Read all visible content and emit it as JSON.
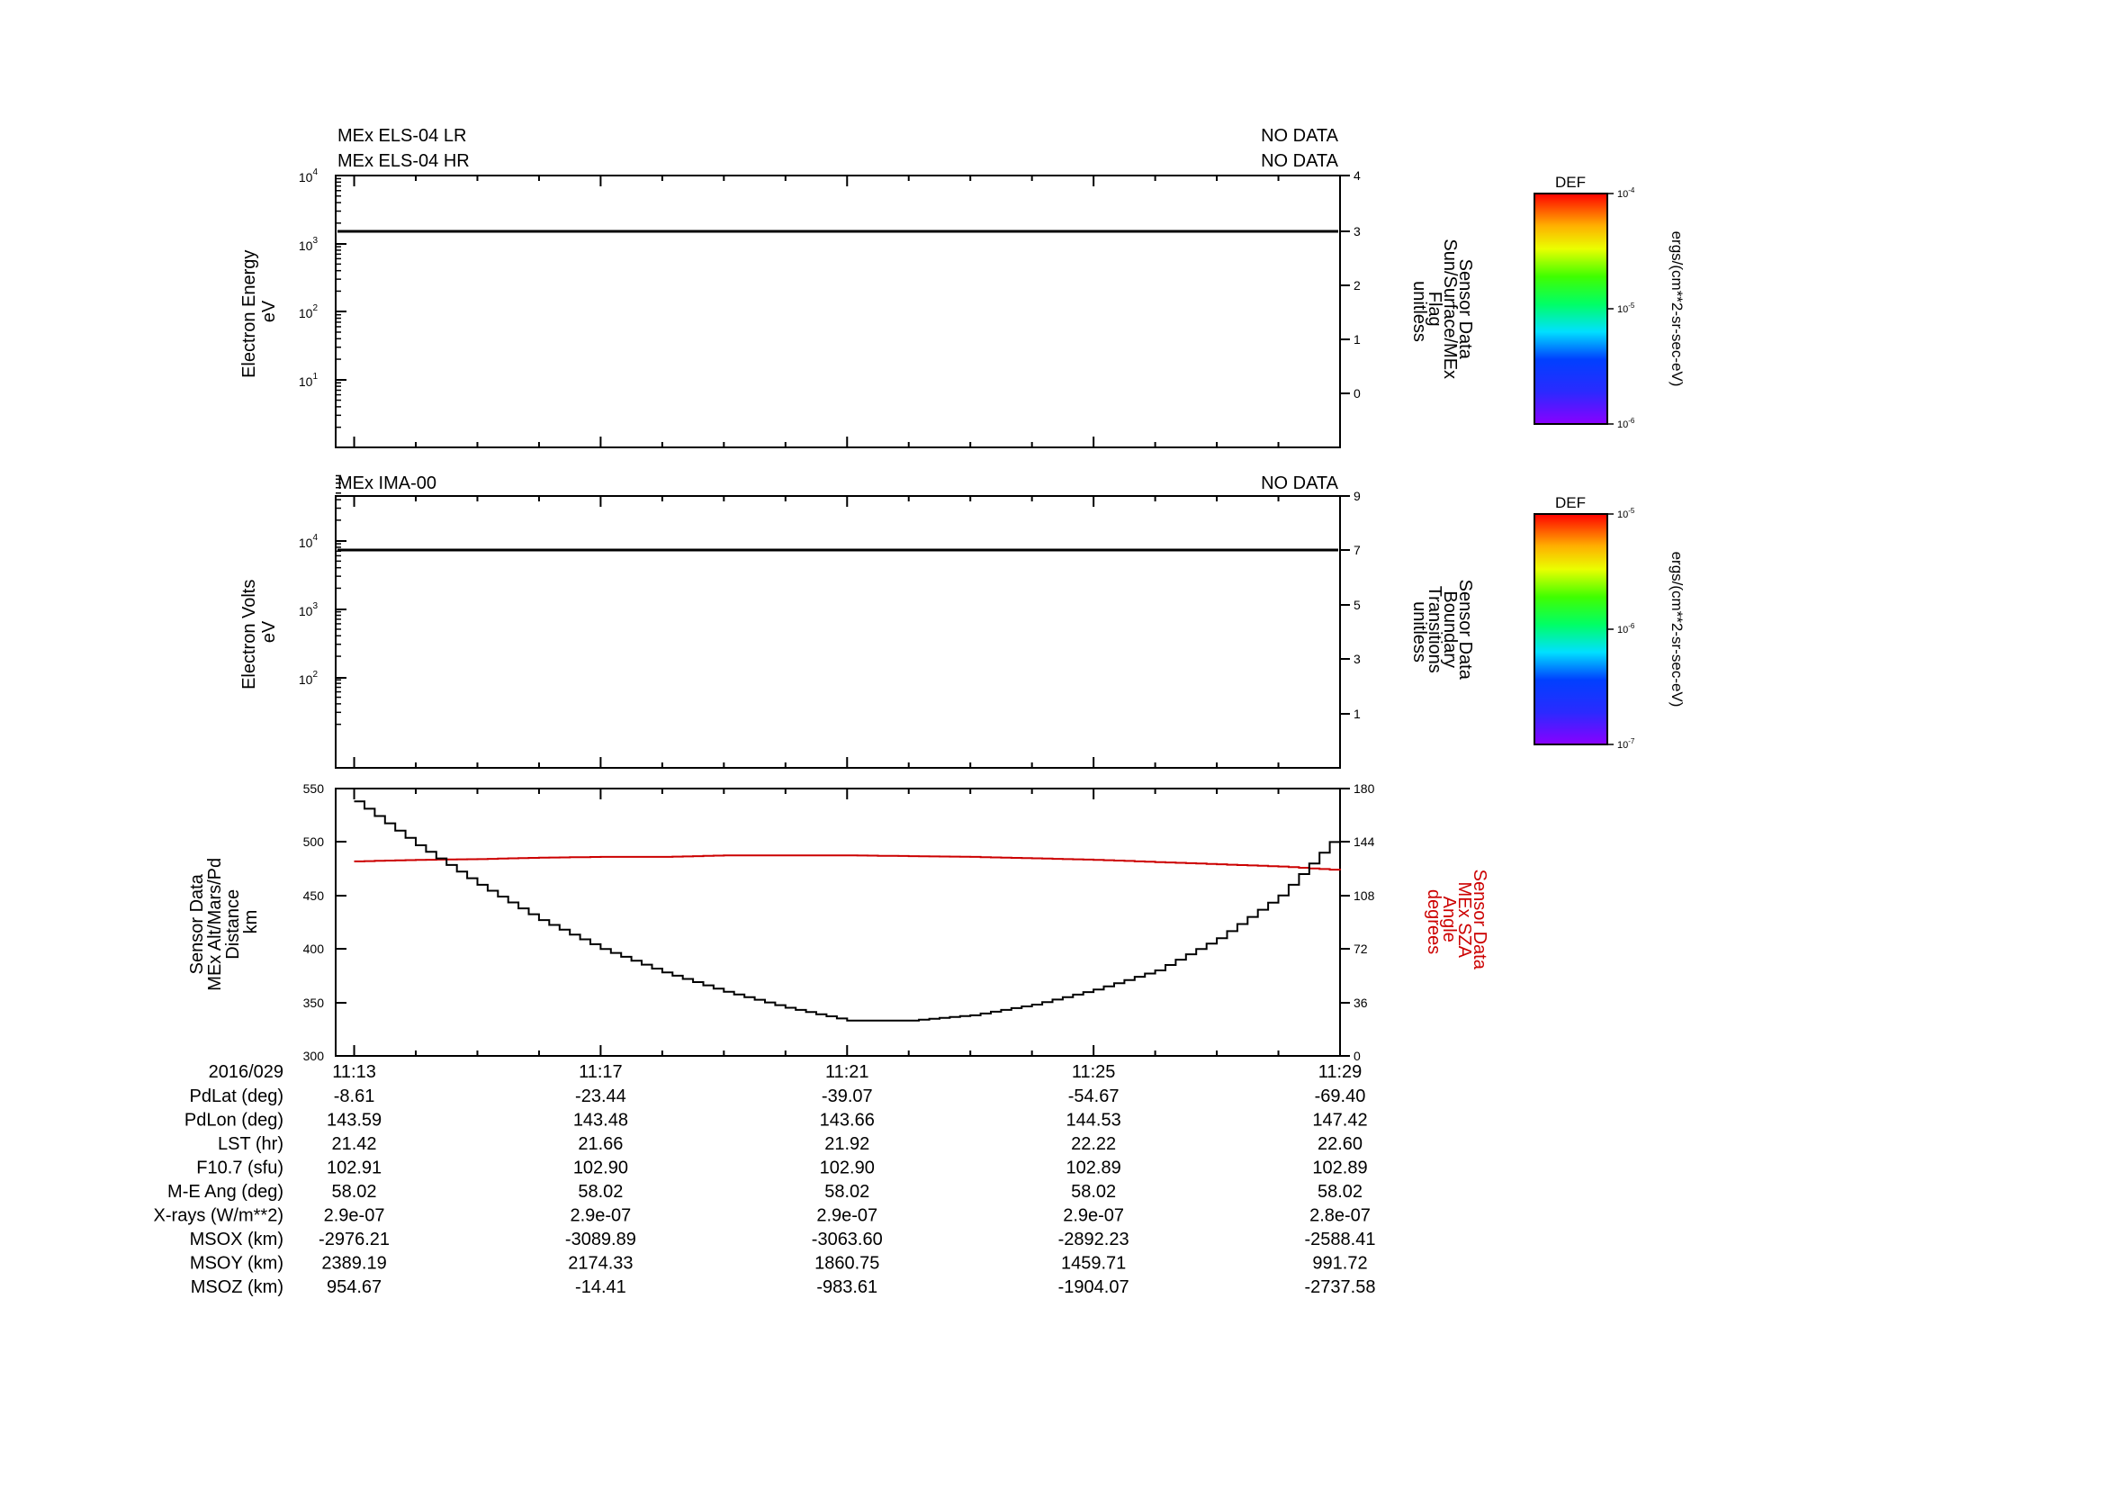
{
  "panels": {
    "els": {
      "labels": [
        "MEx ELS-04 LR",
        "MEx ELS-04 HR"
      ],
      "status": [
        "NO DATA",
        "NO DATA"
      ],
      "ylabel": [
        "Electron Energy",
        "eV"
      ],
      "right_label": [
        "Sensor Data",
        "Sun/Surface/MEx",
        "Flag",
        "unitless"
      ],
      "left_ticks": [
        {
          "base": "10",
          "exp": "4"
        },
        {
          "base": "10",
          "exp": "3"
        },
        {
          "base": "10",
          "exp": "2"
        },
        {
          "base": "10",
          "exp": "1"
        }
      ],
      "right_ticks": [
        "4",
        "3",
        "2",
        "1",
        "0"
      ]
    },
    "ima": {
      "labels": [
        "MEx IMA-00"
      ],
      "status": [
        "NO DATA"
      ],
      "ylabel": [
        "Electron Volts",
        "eV"
      ],
      "right_label": [
        "Sensor Data",
        "Boundary",
        "Transitions",
        "unitless"
      ],
      "left_ticks": [
        {
          "base": "10",
          "exp": "4"
        },
        {
          "base": "10",
          "exp": "3"
        },
        {
          "base": "10",
          "exp": "2"
        }
      ],
      "right_ticks": [
        "9",
        "7",
        "5",
        "3",
        "1"
      ]
    },
    "alt": {
      "ylabel": [
        "Sensor Data",
        "MEx Alt/Mars/Pd",
        "Distance",
        "km"
      ],
      "right_label": [
        "Sensor Data",
        "MEx SZA",
        "Angle",
        "degrees"
      ],
      "left_ticks": [
        "550",
        "500",
        "450",
        "400",
        "350",
        "300"
      ],
      "right_ticks": [
        "180",
        "144",
        "108",
        "72",
        "36",
        "0"
      ]
    }
  },
  "colorbars": [
    {
      "title": "DEF",
      "ticks": [
        {
          "base": "10",
          "exp": "-4"
        },
        {
          "base": "10",
          "exp": "-5"
        },
        {
          "base": "10",
          "exp": "-6"
        }
      ],
      "units": "ergs/(cm**2-sr-sec-eV)"
    },
    {
      "title": "DEF",
      "ticks": [
        {
          "base": "10",
          "exp": "-5"
        },
        {
          "base": "10",
          "exp": "-6"
        },
        {
          "base": "10",
          "exp": "-7"
        }
      ],
      "units": "ergs/(cm**2-sr-sec-eV)"
    }
  ],
  "ephemeris": {
    "date": "2016/029",
    "rows": [
      {
        "label": "PdLat (deg)",
        "values": [
          "-8.61",
          "-23.44",
          "-39.07",
          "-54.67",
          "-69.40"
        ]
      },
      {
        "label": "PdLon (deg)",
        "values": [
          "143.59",
          "143.48",
          "143.66",
          "144.53",
          "147.42"
        ]
      },
      {
        "label": "LST (hr)",
        "values": [
          "21.42",
          "21.66",
          "21.92",
          "22.22",
          "22.60"
        ]
      },
      {
        "label": "F10.7 (sfu)",
        "values": [
          "102.91",
          "102.90",
          "102.90",
          "102.89",
          "102.89"
        ]
      },
      {
        "label": "M-E Ang (deg)",
        "values": [
          "58.02",
          "58.02",
          "58.02",
          "58.02",
          "58.02"
        ]
      },
      {
        "label": "X-rays (W/m**2)",
        "values": [
          "2.9e-07",
          "2.9e-07",
          "2.9e-07",
          "2.9e-07",
          "2.8e-07"
        ]
      },
      {
        "label": "MSOX (km)",
        "values": [
          "-2976.21",
          "-3089.89",
          "-3063.60",
          "-2892.23",
          "-2588.41"
        ]
      },
      {
        "label": "MSOY (km)",
        "values": [
          "2389.19",
          "2174.33",
          "1860.75",
          "1459.71",
          "991.72"
        ]
      },
      {
        "label": "MSOZ (km)",
        "values": [
          "954.67",
          "-14.41",
          "-983.61",
          "-1904.07",
          "-2737.58"
        ]
      }
    ]
  },
  "colors": {
    "axis": "#000000",
    "altitude": "#000000",
    "sza": "#cc0000",
    "sza_label": "#cc0000"
  },
  "chart_data": [
    {
      "type": "line",
      "panel": "els",
      "title": "",
      "xlabel": "",
      "ylabel": "Electron Energy eV",
      "yscale": "log",
      "ylim": [
        1,
        10000
      ],
      "right_ylabel": "Sensor Data Sun/Surface/MEx Flag unitless",
      "right_ylim": [
        -1,
        4
      ],
      "series": [
        {
          "name": "Sensor Data Sun/Surface/MEx Flag",
          "axis": "right",
          "x": [
            "11:12.7",
            "11:29.0"
          ],
          "y": [
            3,
            3
          ]
        }
      ]
    },
    {
      "type": "line",
      "panel": "ima",
      "title": "",
      "xlabel": "",
      "ylabel": "Electron Volts eV",
      "yscale": "log",
      "ylim": [
        1,
        100000
      ],
      "right_ylabel": "Sensor Data Boundary Transitions unitless",
      "right_ylim": [
        -1,
        9
      ],
      "series": [
        {
          "name": "Sensor Data Boundary Transitions",
          "axis": "right",
          "x": [
            "11:12.7",
            "11:29.0"
          ],
          "y": [
            7,
            7
          ]
        }
      ]
    },
    {
      "type": "line",
      "panel": "alt",
      "title": "",
      "xlabel": "",
      "x": [
        "11:13",
        "11:14",
        "11:15",
        "11:16",
        "11:17",
        "11:18",
        "11:19",
        "11:20",
        "11:21",
        "11:22",
        "11:23",
        "11:24",
        "11:25",
        "11:26",
        "11:27",
        "11:28",
        "11:29"
      ],
      "x_ticks": [
        "11:13",
        "11:17",
        "11:21",
        "11:25",
        "11:29"
      ],
      "ylim": [
        300,
        550
      ],
      "right_ylim": [
        0,
        180
      ],
      "series": [
        {
          "name": "Sensor Data MEx Alt/Mars/Pd Distance km",
          "axis": "left",
          "color": "#000000",
          "values": [
            538,
            497,
            460,
            427,
            400,
            378,
            360,
            345,
            333,
            333,
            338,
            348,
            362,
            380,
            410,
            450,
            510
          ]
        },
        {
          "name": "Sensor Data MEx SZA Angle degrees",
          "axis": "right",
          "color": "#cc0000",
          "values": [
            131,
            132,
            132.5,
            133.5,
            134,
            134,
            135,
            135,
            135,
            134.5,
            134,
            133,
            132,
            130.5,
            129,
            127.5,
            125
          ]
        }
      ]
    }
  ]
}
